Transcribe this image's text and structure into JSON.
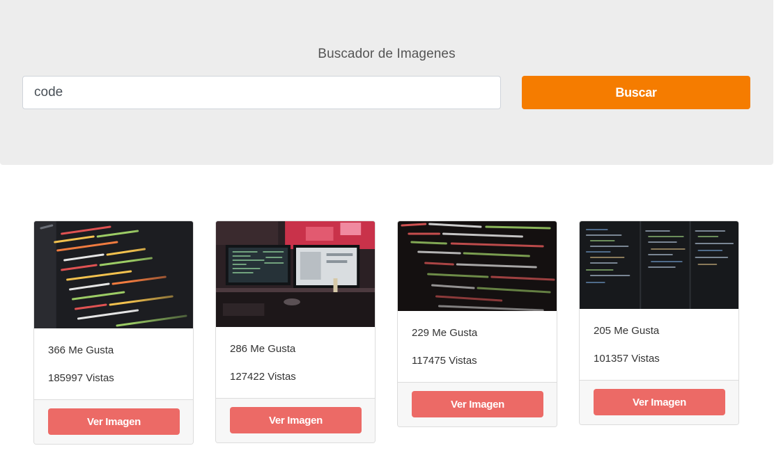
{
  "search": {
    "title": "Buscador de Imagenes",
    "input_value": "code",
    "button_label": "Buscar"
  },
  "colors": {
    "jumbotron_bg": "#ededed",
    "search_button": "#f57c00",
    "card_button": "#ec6a66"
  },
  "results": [
    {
      "likes": "366 Me Gusta",
      "views": "185997 Vistas",
      "button_label": "Ver Imagen",
      "image_subject": "code-editor-screen-angled"
    },
    {
      "likes": "286 Me Gusta",
      "views": "127422 Vistas",
      "button_label": "Ver Imagen",
      "image_subject": "desk-dual-monitors"
    },
    {
      "likes": "229 Me Gusta",
      "views": "117475 Vistas",
      "button_label": "Ver Imagen",
      "image_subject": "html-code-close-up"
    },
    {
      "likes": "205 Me Gusta",
      "views": "101357 Vistas",
      "button_label": "Ver Imagen",
      "image_subject": "dark-code-editor-columns"
    }
  ]
}
